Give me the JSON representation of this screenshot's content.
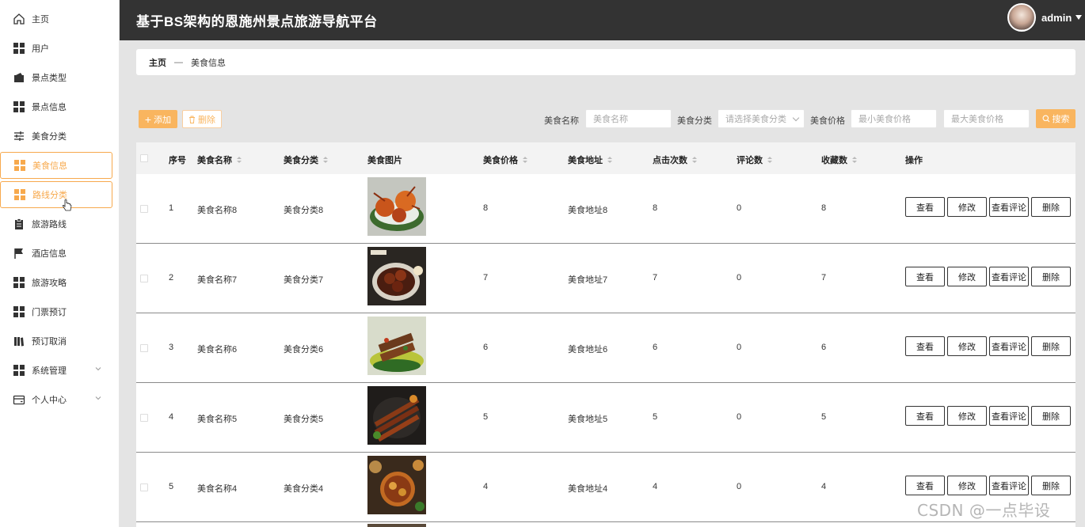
{
  "header": {
    "title": "基于BS架构的恩施州景点旅游导航平台",
    "user": "admin"
  },
  "sidebar": {
    "items": [
      {
        "label": "主页",
        "icon": "home-icon"
      },
      {
        "label": "用户",
        "icon": "grid-icon"
      },
      {
        "label": "景点类型",
        "icon": "wallet-icon"
      },
      {
        "label": "景点信息",
        "icon": "grid-icon"
      },
      {
        "label": "美食分类",
        "icon": "sliders-icon"
      },
      {
        "label": "美食信息",
        "icon": "grid-icon",
        "state": "active"
      },
      {
        "label": "路线分类",
        "icon": "grid-icon",
        "state": "hover"
      },
      {
        "label": "旅游路线",
        "icon": "clipboard-icon"
      },
      {
        "label": "酒店信息",
        "icon": "flag-icon"
      },
      {
        "label": "旅游攻略",
        "icon": "grid-icon"
      },
      {
        "label": "门票预订",
        "icon": "grid-icon"
      },
      {
        "label": "预订取消",
        "icon": "books-icon"
      },
      {
        "label": "系统管理",
        "icon": "grid-icon",
        "expandable": true
      },
      {
        "label": "个人中心",
        "icon": "card-icon",
        "expandable": true
      }
    ]
  },
  "breadcrumb": {
    "home": "主页",
    "sep": "—",
    "current": "美食信息"
  },
  "toolbar": {
    "add": "添加",
    "delete": "删除",
    "search": "搜索",
    "filters": {
      "name_label": "美食名称",
      "name_placeholder": "美食名称",
      "category_label": "美食分类",
      "category_placeholder": "请选择美食分类",
      "price_label": "美食价格",
      "price_min_placeholder": "最小美食价格",
      "price_max_placeholder": "最大美食价格"
    }
  },
  "table": {
    "columns": [
      "序号",
      "美食名称",
      "美食分类",
      "美食图片",
      "美食价格",
      "美食地址",
      "点击次数",
      "评论数",
      "收藏数",
      "操作"
    ],
    "actions": [
      "查看",
      "修改",
      "查看评论",
      "删除"
    ],
    "rows": [
      {
        "index": "1",
        "name": "美食名称8",
        "category": "美食分类8",
        "price": "8",
        "address": "美食地址8",
        "clicks": "8",
        "comments": "0",
        "favorites": "8"
      },
      {
        "index": "2",
        "name": "美食名称7",
        "category": "美食分类7",
        "price": "7",
        "address": "美食地址7",
        "clicks": "7",
        "comments": "0",
        "favorites": "7"
      },
      {
        "index": "3",
        "name": "美食名称6",
        "category": "美食分类6",
        "price": "6",
        "address": "美食地址6",
        "clicks": "6",
        "comments": "0",
        "favorites": "6"
      },
      {
        "index": "4",
        "name": "美食名称5",
        "category": "美食分类5",
        "price": "5",
        "address": "美食地址5",
        "clicks": "5",
        "comments": "0",
        "favorites": "5"
      },
      {
        "index": "5",
        "name": "美食名称4",
        "category": "美食分类4",
        "price": "4",
        "address": "美食地址4",
        "clicks": "4",
        "comments": "0",
        "favorites": "4"
      }
    ]
  },
  "watermark": "CSDN @一点毕设",
  "colors": {
    "accent": "#f9b55f",
    "header_bg": "#333333",
    "sidebar_active": "#f7a94d"
  }
}
